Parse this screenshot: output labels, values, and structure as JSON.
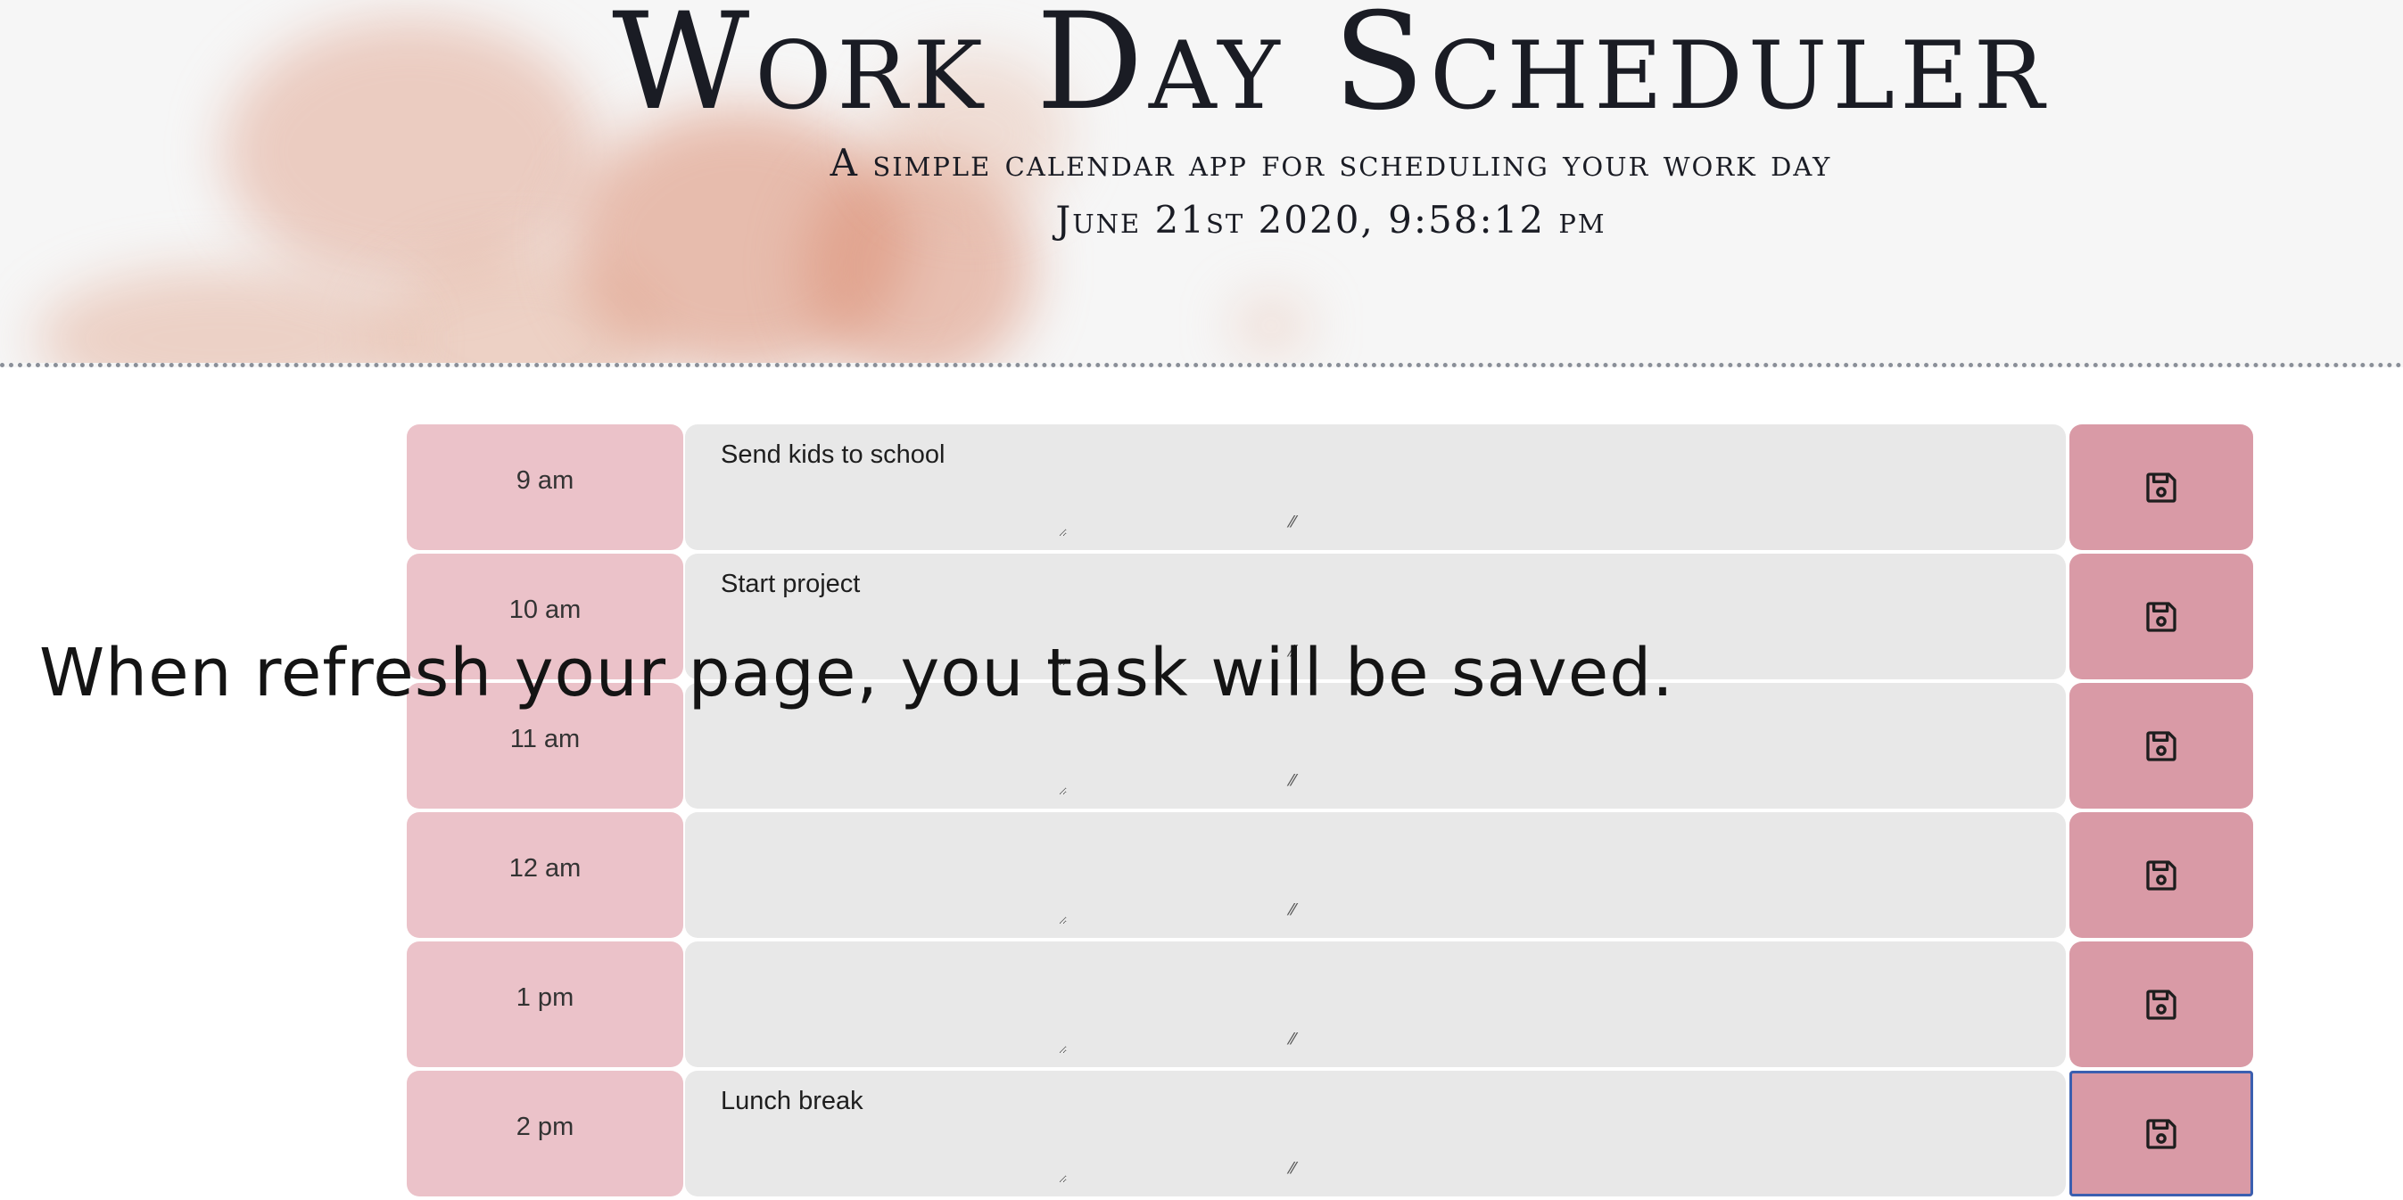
{
  "header": {
    "title": "Work Day Scheduler",
    "subtitle": "A simple calendar app for scheduling your work day",
    "datetime": "June 21st 2020, 9:58:12 pm"
  },
  "rows": [
    {
      "hour": "9 am",
      "task": "Send kids to school"
    },
    {
      "hour": "10 am",
      "task": "Start project"
    },
    {
      "hour": "11 am",
      "task": ""
    },
    {
      "hour": "12 am",
      "task": ""
    },
    {
      "hour": "1 pm",
      "task": ""
    },
    {
      "hour": "2 pm",
      "task": "Lunch break"
    }
  ],
  "overlay": {
    "message": "When refresh your page, you task will be saved."
  },
  "icons": {
    "save": "floppy-disk-icon"
  },
  "colors": {
    "hour_bg": "#ebc2c9",
    "task_bg": "#e8e8e8",
    "save_bg": "#d99aa6",
    "focus_outline": "#3b5fb0"
  }
}
